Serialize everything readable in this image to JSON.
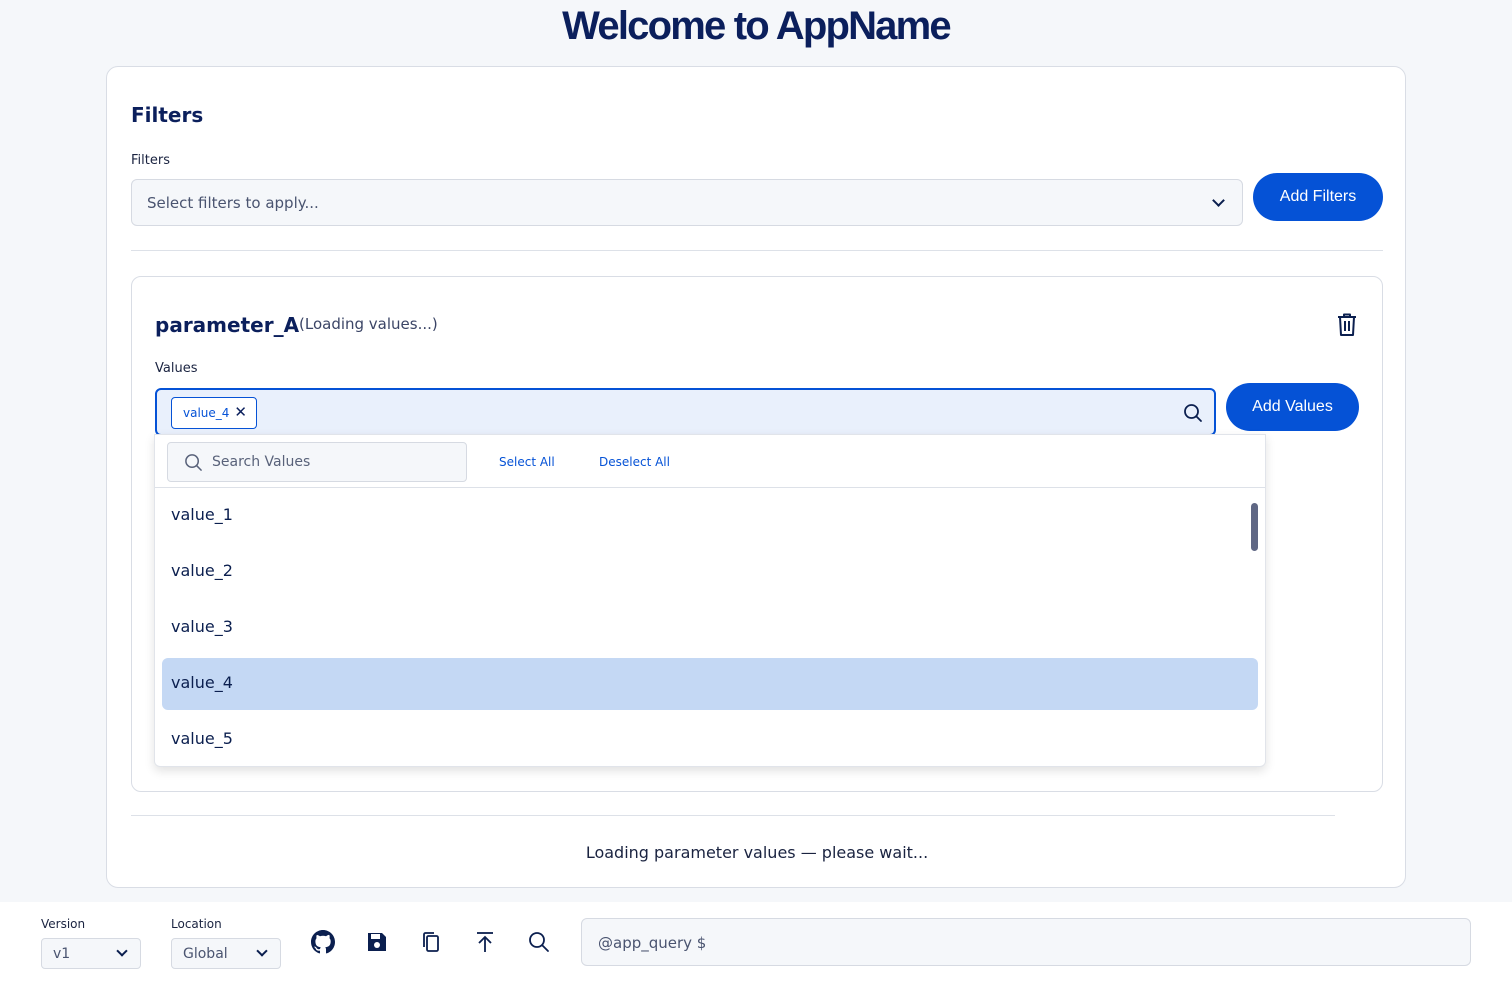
{
  "header": {
    "title": "Welcome to AppName"
  },
  "filters_section": {
    "heading": "Filters",
    "field_label": "Filters",
    "select_placeholder": "Select filters to apply...",
    "add_button": "Add Filters"
  },
  "parameter": {
    "name": "parameter_A",
    "status": "(Loading values...)",
    "values_label": "Values",
    "selected_chips": [
      "value_4"
    ],
    "chip_remove": "✕",
    "add_button": "Add Values"
  },
  "dropdown": {
    "search_placeholder": "Search Values",
    "select_all": "Select All",
    "deselect_all": "Deselect All",
    "items": [
      "value_1",
      "value_2",
      "value_3",
      "value_4",
      "value_5"
    ],
    "selected_item": "value_4"
  },
  "loading_message": "Loading parameter values — please wait...",
  "footer": {
    "version_label": "Version",
    "version_value": "v1",
    "location_label": "Location",
    "location_value": "Global",
    "icons": [
      "github-icon",
      "save-icon",
      "copy-icon",
      "upload-icon",
      "search-icon"
    ],
    "query_placeholder": "@app_query $"
  },
  "colors": {
    "primary": "#0552d6",
    "title": "#0b1f5c",
    "selected_row": "#c4d8f4"
  }
}
